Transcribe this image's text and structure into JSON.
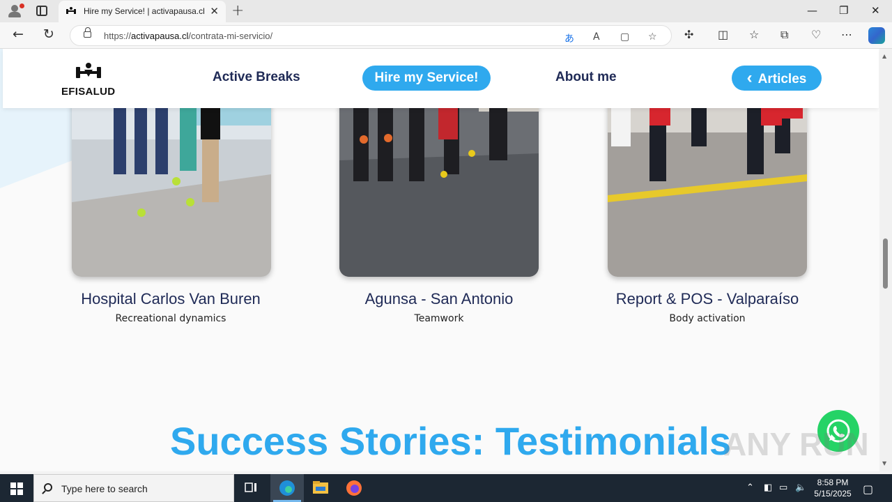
{
  "browser": {
    "tab_title": "Hire my Service! | activapausa.cl",
    "tab_close": "✕",
    "new_tab": "+",
    "url_prefix": "https://",
    "url_domain": "activapausa.cl",
    "url_path": "/contrata-mi-servicio/",
    "window_controls": {
      "minimize": "—",
      "maximize": "❐",
      "close": "✕"
    }
  },
  "site": {
    "logo_text": "EFISALUD",
    "nav": {
      "active_breaks": "Active Breaks",
      "hire": "Hire my Service!",
      "about": "About me",
      "articles": "Articles",
      "articles_chevron": "‹"
    }
  },
  "cards": [
    {
      "title": "Hospital Carlos Van Buren",
      "subtitle": "Recreational dynamics"
    },
    {
      "title": "Agunsa - San Antonio",
      "subtitle": "Teamwork"
    },
    {
      "title": "Report & POS - Valparaíso",
      "subtitle": "Body activation"
    }
  ],
  "section_heading": "Success Stories: Testimonials",
  "watermark": "ANY RUN",
  "taskbar": {
    "search_placeholder": "Type here to search",
    "time": "8:58 PM",
    "date": "5/15/2025"
  },
  "colors": {
    "accent": "#2fa9ee",
    "nav_text": "#1f2a56",
    "whatsapp": "#25d366"
  }
}
